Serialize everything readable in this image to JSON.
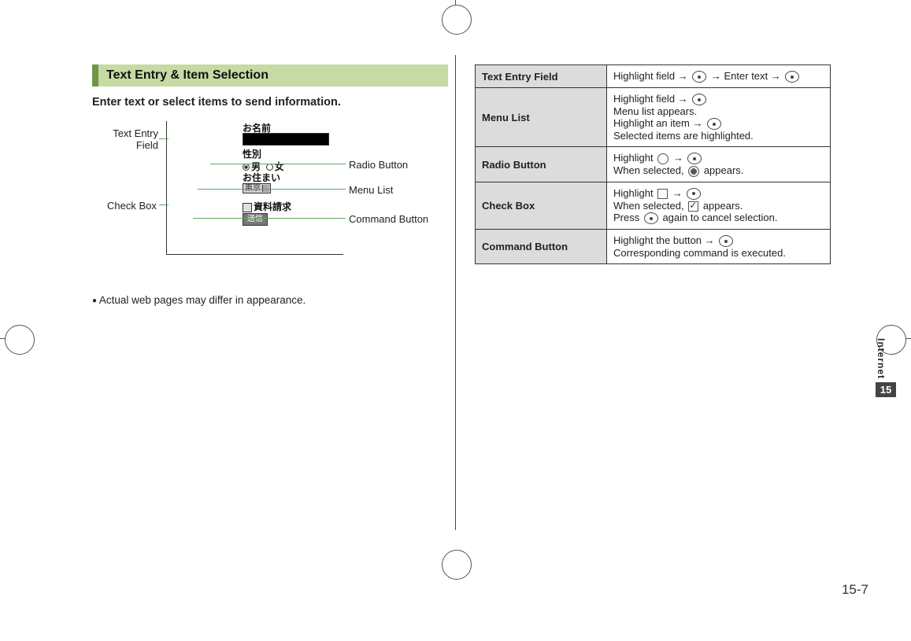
{
  "heading": "Text Entry & Item Selection",
  "lead": "Enter text or select items to send information.",
  "diagram": {
    "name_label": "お名前",
    "sex_label": "性別",
    "sex_male": "男",
    "sex_female": "女",
    "address_label": "お住まい",
    "select_value": "東京",
    "checkbox_label": "資料請求",
    "send_label": "送信"
  },
  "callouts": {
    "text_entry": "Text Entry",
    "field": "Field",
    "radio_button": "Radio Button",
    "menu_list": "Menu List",
    "check_box": "Check Box",
    "command_button": "Command Button"
  },
  "note": "Actual web pages may differ in appearance.",
  "table": {
    "rows": [
      {
        "label": "Text Entry Field",
        "lines": [
          "Highlight field → ",
          "  → Enter text → "
        ]
      },
      {
        "label": "Menu List",
        "lines": [
          "Highlight field → ",
          "Menu list appears.",
          "Highlight an item → ",
          "Selected items are highlighted."
        ]
      },
      {
        "label": "Radio Button",
        "lines": [
          "Highlight ",
          "  → ",
          "When selected, ",
          "  appears."
        ]
      },
      {
        "label": "Check Box",
        "lines": [
          "Highlight ",
          " → ",
          "When selected, ",
          " appears.",
          "Press ",
          "  again to cancel selection."
        ]
      },
      {
        "label": "Command Button",
        "lines": [
          "Highlight the button → ",
          "Corresponding command is executed."
        ]
      }
    ]
  },
  "side": {
    "label": "Internet",
    "chapter": "15"
  },
  "page_number": "15-7"
}
